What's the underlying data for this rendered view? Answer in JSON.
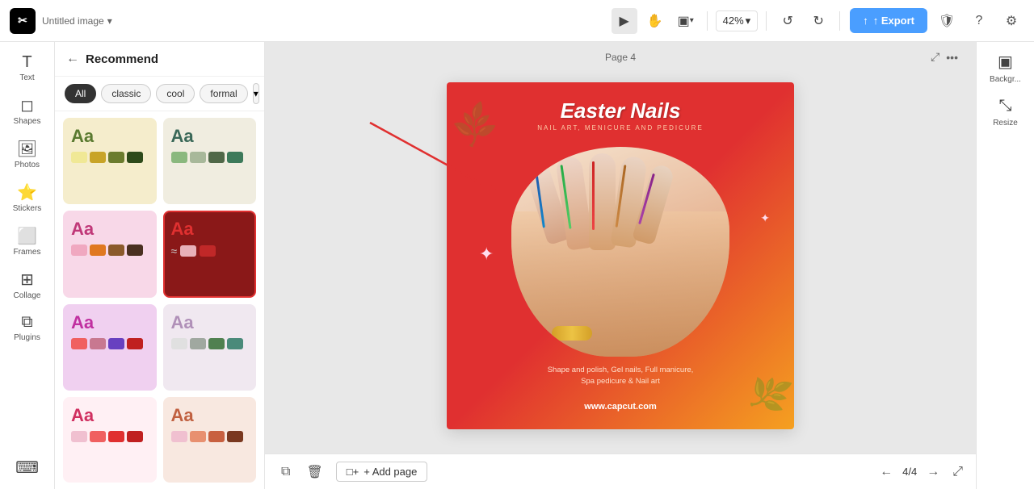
{
  "app": {
    "logo": "✂",
    "title": "Untitled image",
    "title_caret": "▾"
  },
  "topbar": {
    "tools": {
      "select": "▶",
      "hand": "✋",
      "layout": "▣",
      "layout_caret": "▾",
      "zoom": "42%",
      "zoom_caret": "▾",
      "undo": "↺",
      "redo": "↻"
    },
    "export_label": "↑ Export",
    "shield_icon": "🛡",
    "help_icon": "?",
    "settings_icon": "⚙"
  },
  "left_sidebar": {
    "items": [
      {
        "id": "brand",
        "label": "",
        "icon": "✂"
      },
      {
        "id": "text",
        "label": "Text",
        "icon": "T"
      },
      {
        "id": "shapes",
        "label": "Shapes",
        "icon": "◻"
      },
      {
        "id": "photos",
        "label": "Photos",
        "icon": "🖼"
      },
      {
        "id": "stickers",
        "label": "Stickers",
        "icon": "⭐"
      },
      {
        "id": "frames",
        "label": "Frames",
        "icon": "⬜"
      },
      {
        "id": "collage",
        "label": "Collage",
        "icon": "⊞"
      },
      {
        "id": "plugins",
        "label": "Plugins",
        "icon": "⧉"
      },
      {
        "id": "keyboard",
        "label": "",
        "icon": "⌨"
      }
    ]
  },
  "recommend_panel": {
    "back_label": "←",
    "title": "Recommend",
    "filters": [
      {
        "id": "all",
        "label": "All",
        "active": true
      },
      {
        "id": "classic",
        "label": "classic",
        "active": false
      },
      {
        "id": "cool",
        "label": "cool",
        "active": false
      },
      {
        "id": "formal",
        "label": "formal",
        "active": false
      }
    ],
    "more_icon": "▾",
    "styles": [
      {
        "id": "style-1",
        "aa_color": "#5a7a30",
        "bg": "#f5edcc",
        "selected": false,
        "swatches": [
          "palette-yellow",
          "palette-gold",
          "palette-olive",
          "palette-dark-green"
        ]
      },
      {
        "id": "style-2",
        "aa_color": "#3a6858",
        "bg": "#f0ede0",
        "selected": false,
        "swatches": [
          "palette-light-green",
          "palette-sage",
          "palette-dark-sage",
          "palette-green"
        ]
      },
      {
        "id": "style-3",
        "aa_color": "#c03878",
        "bg": "#f8d8e8",
        "selected": false,
        "swatches": [
          "palette-pink",
          "palette-orange",
          "palette-brown",
          "palette-dark-brown"
        ]
      },
      {
        "id": "style-4",
        "aa_color": "#e03030",
        "bg": "#c02828",
        "selected": true,
        "swatches": [
          "palette-selected-main",
          "palette-selected-dark"
        ]
      },
      {
        "id": "style-5",
        "aa_color": "#c030a0",
        "bg": "#f0d0f0",
        "selected": false,
        "swatches": [
          "palette-coral",
          "palette-mauve",
          "palette-purple",
          "palette-dark-red"
        ]
      },
      {
        "id": "style-6",
        "aa_color": "#b090b8",
        "bg": "#f0e8f0",
        "selected": false,
        "swatches": [
          "palette-light-gray",
          "palette-medium-gray",
          "palette-medium-green",
          "palette-teal"
        ]
      },
      {
        "id": "style-7",
        "aa_color": "#d03060",
        "bg": "#fff0f4",
        "selected": false,
        "swatches": [
          "palette-soft-pink",
          "palette-coral",
          "palette-red",
          "palette-dark-red"
        ]
      },
      {
        "id": "style-8",
        "aa_color": "#c06040",
        "bg": "#f8e8e0",
        "selected": false,
        "swatches": [
          "palette-soft-pink",
          "palette-salmon",
          "palette-terracotta",
          "palette-dark-terracotta"
        ]
      }
    ]
  },
  "canvas": {
    "page_label": "Page 4",
    "title": "Easter Nails",
    "arc_text": "NAIL ART, MENICURE AND PEDICURE",
    "bottom_text": "Shape and polish, Gel nails, Full manicure,\nSpa pedicure & Nail art",
    "url": "www.capcut.com"
  },
  "bottom_toolbar": {
    "copy_icon": "⧉",
    "delete_icon": "🗑",
    "add_page_label": "+ Add page",
    "page_back": "←",
    "page_info": "4/4",
    "page_forward": "→",
    "expand_icon": "⤢"
  },
  "right_panel": {
    "items": [
      {
        "id": "background",
        "label": "Backgr...",
        "icon": "▣"
      },
      {
        "id": "resize",
        "label": "Resize",
        "icon": "⤡"
      }
    ]
  }
}
